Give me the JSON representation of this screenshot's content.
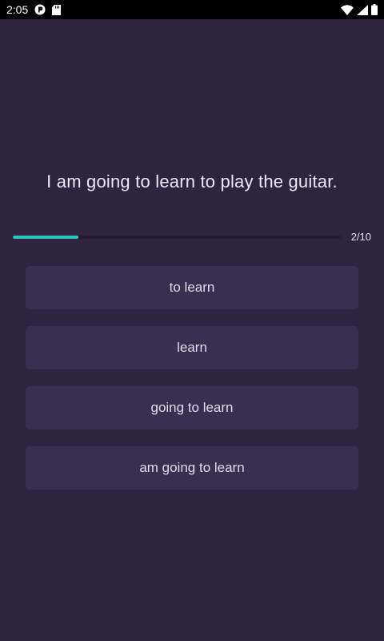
{
  "status_bar": {
    "time": "2:05",
    "icons": [
      "app-notification-icon",
      "sd-card-icon",
      "wifi-icon",
      "signal-icon",
      "battery-icon"
    ]
  },
  "quiz": {
    "question": "I am going to learn to play the guitar.",
    "progress": {
      "label": "2/10",
      "current": 2,
      "total": 10,
      "fraction": 0.2,
      "fill_color": "#27c7c0"
    },
    "options": [
      {
        "label": "to learn"
      },
      {
        "label": "learn"
      },
      {
        "label": "going to learn"
      },
      {
        "label": "am going to learn"
      }
    ]
  },
  "colors": {
    "background": "#2f2340",
    "option_background": "#3c2e50",
    "text": "#ece8f2"
  }
}
